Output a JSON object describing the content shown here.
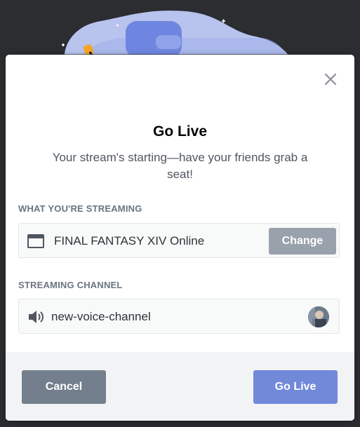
{
  "modal": {
    "title": "Go Live",
    "subtitle": "Your stream's starting—have your friends grab a seat!"
  },
  "streaming_section": {
    "label": "WHAT YOU'RE STREAMING",
    "app_name": "FINAL FANTASY XIV Online",
    "change_label": "Change",
    "icon": "app-window-icon"
  },
  "channel_section": {
    "label": "STREAMING CHANNEL",
    "channel_name": "new-voice-channel",
    "icon": "speaker-icon"
  },
  "footer": {
    "cancel_label": "Cancel",
    "go_live_label": "Go Live"
  },
  "colors": {
    "brand": "#7289da",
    "cancel": "#747f8d",
    "change": "#99a1ac"
  }
}
